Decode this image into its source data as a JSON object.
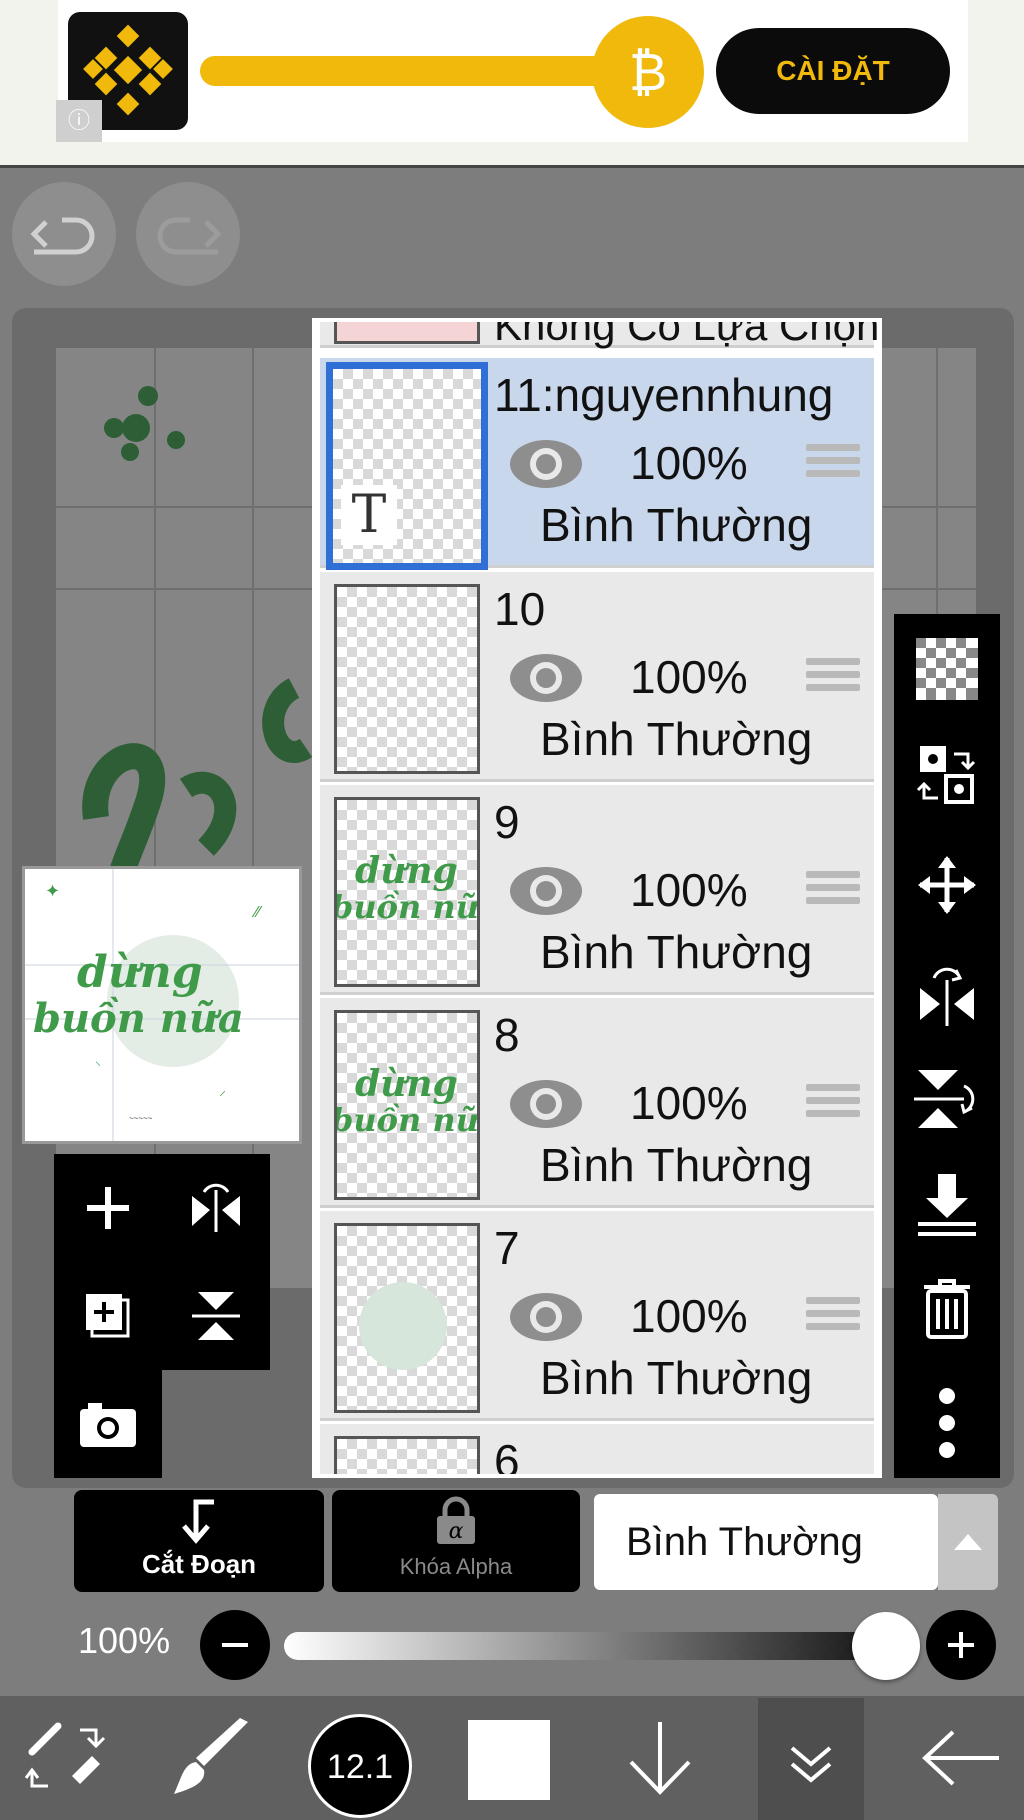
{
  "ad": {
    "button_label": "CÀI ĐẶT",
    "info_icon": "info-icon",
    "coin_symbol": "₿",
    "brand_color": "#f0b90b"
  },
  "toolbar_top": {
    "undo_icon": "undo-icon",
    "redo_icon": "redo-icon"
  },
  "layers_panel": {
    "top_partial_label": "Không Có Lựa Chọn",
    "layers": [
      {
        "name": "11:nguyennhung",
        "opacity": "100%",
        "blend": "Bình Thường",
        "selected": true,
        "text_layer_icon": "T"
      },
      {
        "name": "10",
        "opacity": "100%",
        "blend": "Bình Thường",
        "selected": false
      },
      {
        "name": "9",
        "opacity": "100%",
        "blend": "Bình Thường",
        "selected": false,
        "thumb_text": [
          "dừng",
          "buồn nữa"
        ]
      },
      {
        "name": "8",
        "opacity": "100%",
        "blend": "Bình Thường",
        "selected": false,
        "thumb_text": [
          "dừng",
          "buồn nữa"
        ]
      },
      {
        "name": "7",
        "opacity": "100%",
        "blend": "Bình Thường",
        "selected": false
      }
    ],
    "bottom_partial_name": "6"
  },
  "preview": {
    "text_line1": "dừng",
    "text_line2": "buồn nữa"
  },
  "controls": {
    "clip_label": "Cắt Đoạn",
    "alpha_lock_label": "Khóa Alpha",
    "blend_mode": "Bình Thường",
    "opacity_label": "100%",
    "opacity_value": 1.0
  },
  "bottom_bar": {
    "brush_size": "12.1",
    "primary_color": "#ffffff"
  }
}
